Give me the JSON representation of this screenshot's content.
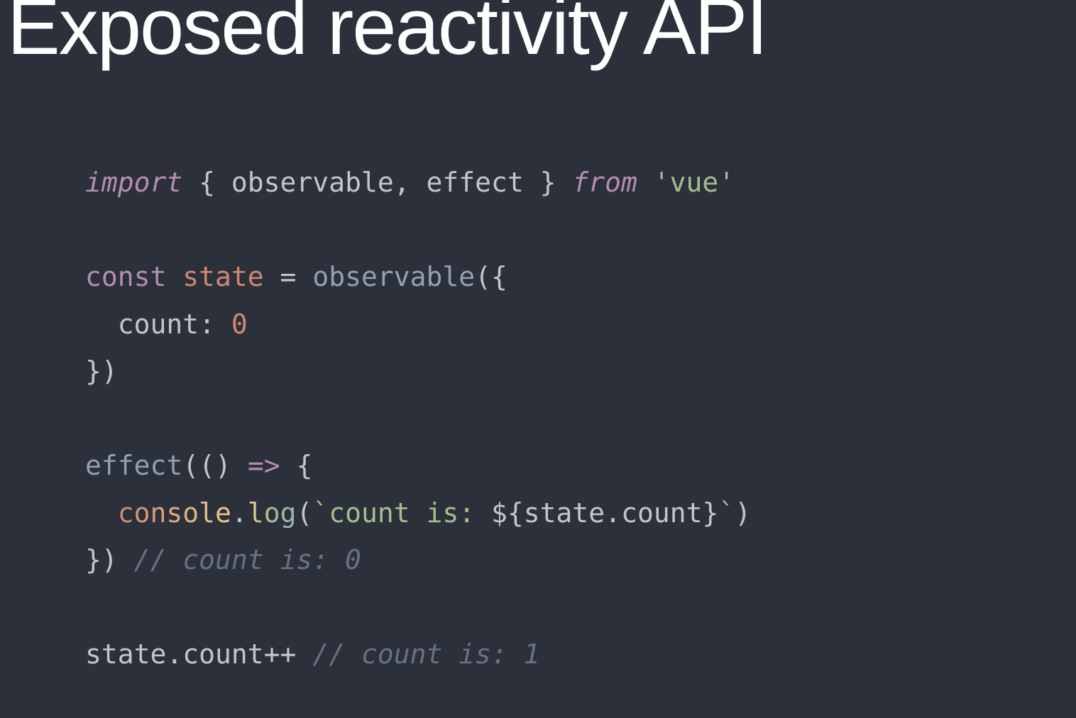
{
  "slide": {
    "title": "Exposed reactivity API"
  },
  "code": {
    "line1": {
      "import": "import",
      "brace_open": " { ",
      "sym1": "observable",
      "comma": ", ",
      "sym2": "effect",
      "brace_close": " } ",
      "from": "from",
      "space": " ",
      "module": "'vue'"
    },
    "line3": {
      "const": "const",
      "space1": " ",
      "varname": "state",
      "eq": " = ",
      "fn": "observable",
      "call_open": "({"
    },
    "line4": {
      "indent": "  ",
      "key": "count",
      "colon": ": ",
      "value": "0"
    },
    "line5": {
      "close": "})"
    },
    "line7": {
      "fn": "effect",
      "open": "(",
      "params": "()",
      "arrow": " => ",
      "brace": "{"
    },
    "line8": {
      "indent": "  ",
      "console": "console",
      "dot": ".",
      "log": "log",
      "open": "(",
      "tmpl_open": "`count is: ",
      "interp_open": "${",
      "obj": "state",
      "dot2": ".",
      "prop": "count",
      "interp_close": "}",
      "tmpl_close": "`",
      "close": ")"
    },
    "line9": {
      "close": "}) ",
      "comment": "// count is: 0"
    },
    "line11": {
      "obj": "state",
      "dot": ".",
      "prop": "count",
      "op": "++ ",
      "comment": "// count is: 1"
    }
  },
  "colors": {
    "background": "#2b303b",
    "text_default": "#c0c5ce",
    "keyword": "#b48ead",
    "string": "#a3be8c",
    "number": "#d08770",
    "function": "#8fa1b3",
    "comment": "#65737e",
    "title": "#ffffff"
  }
}
